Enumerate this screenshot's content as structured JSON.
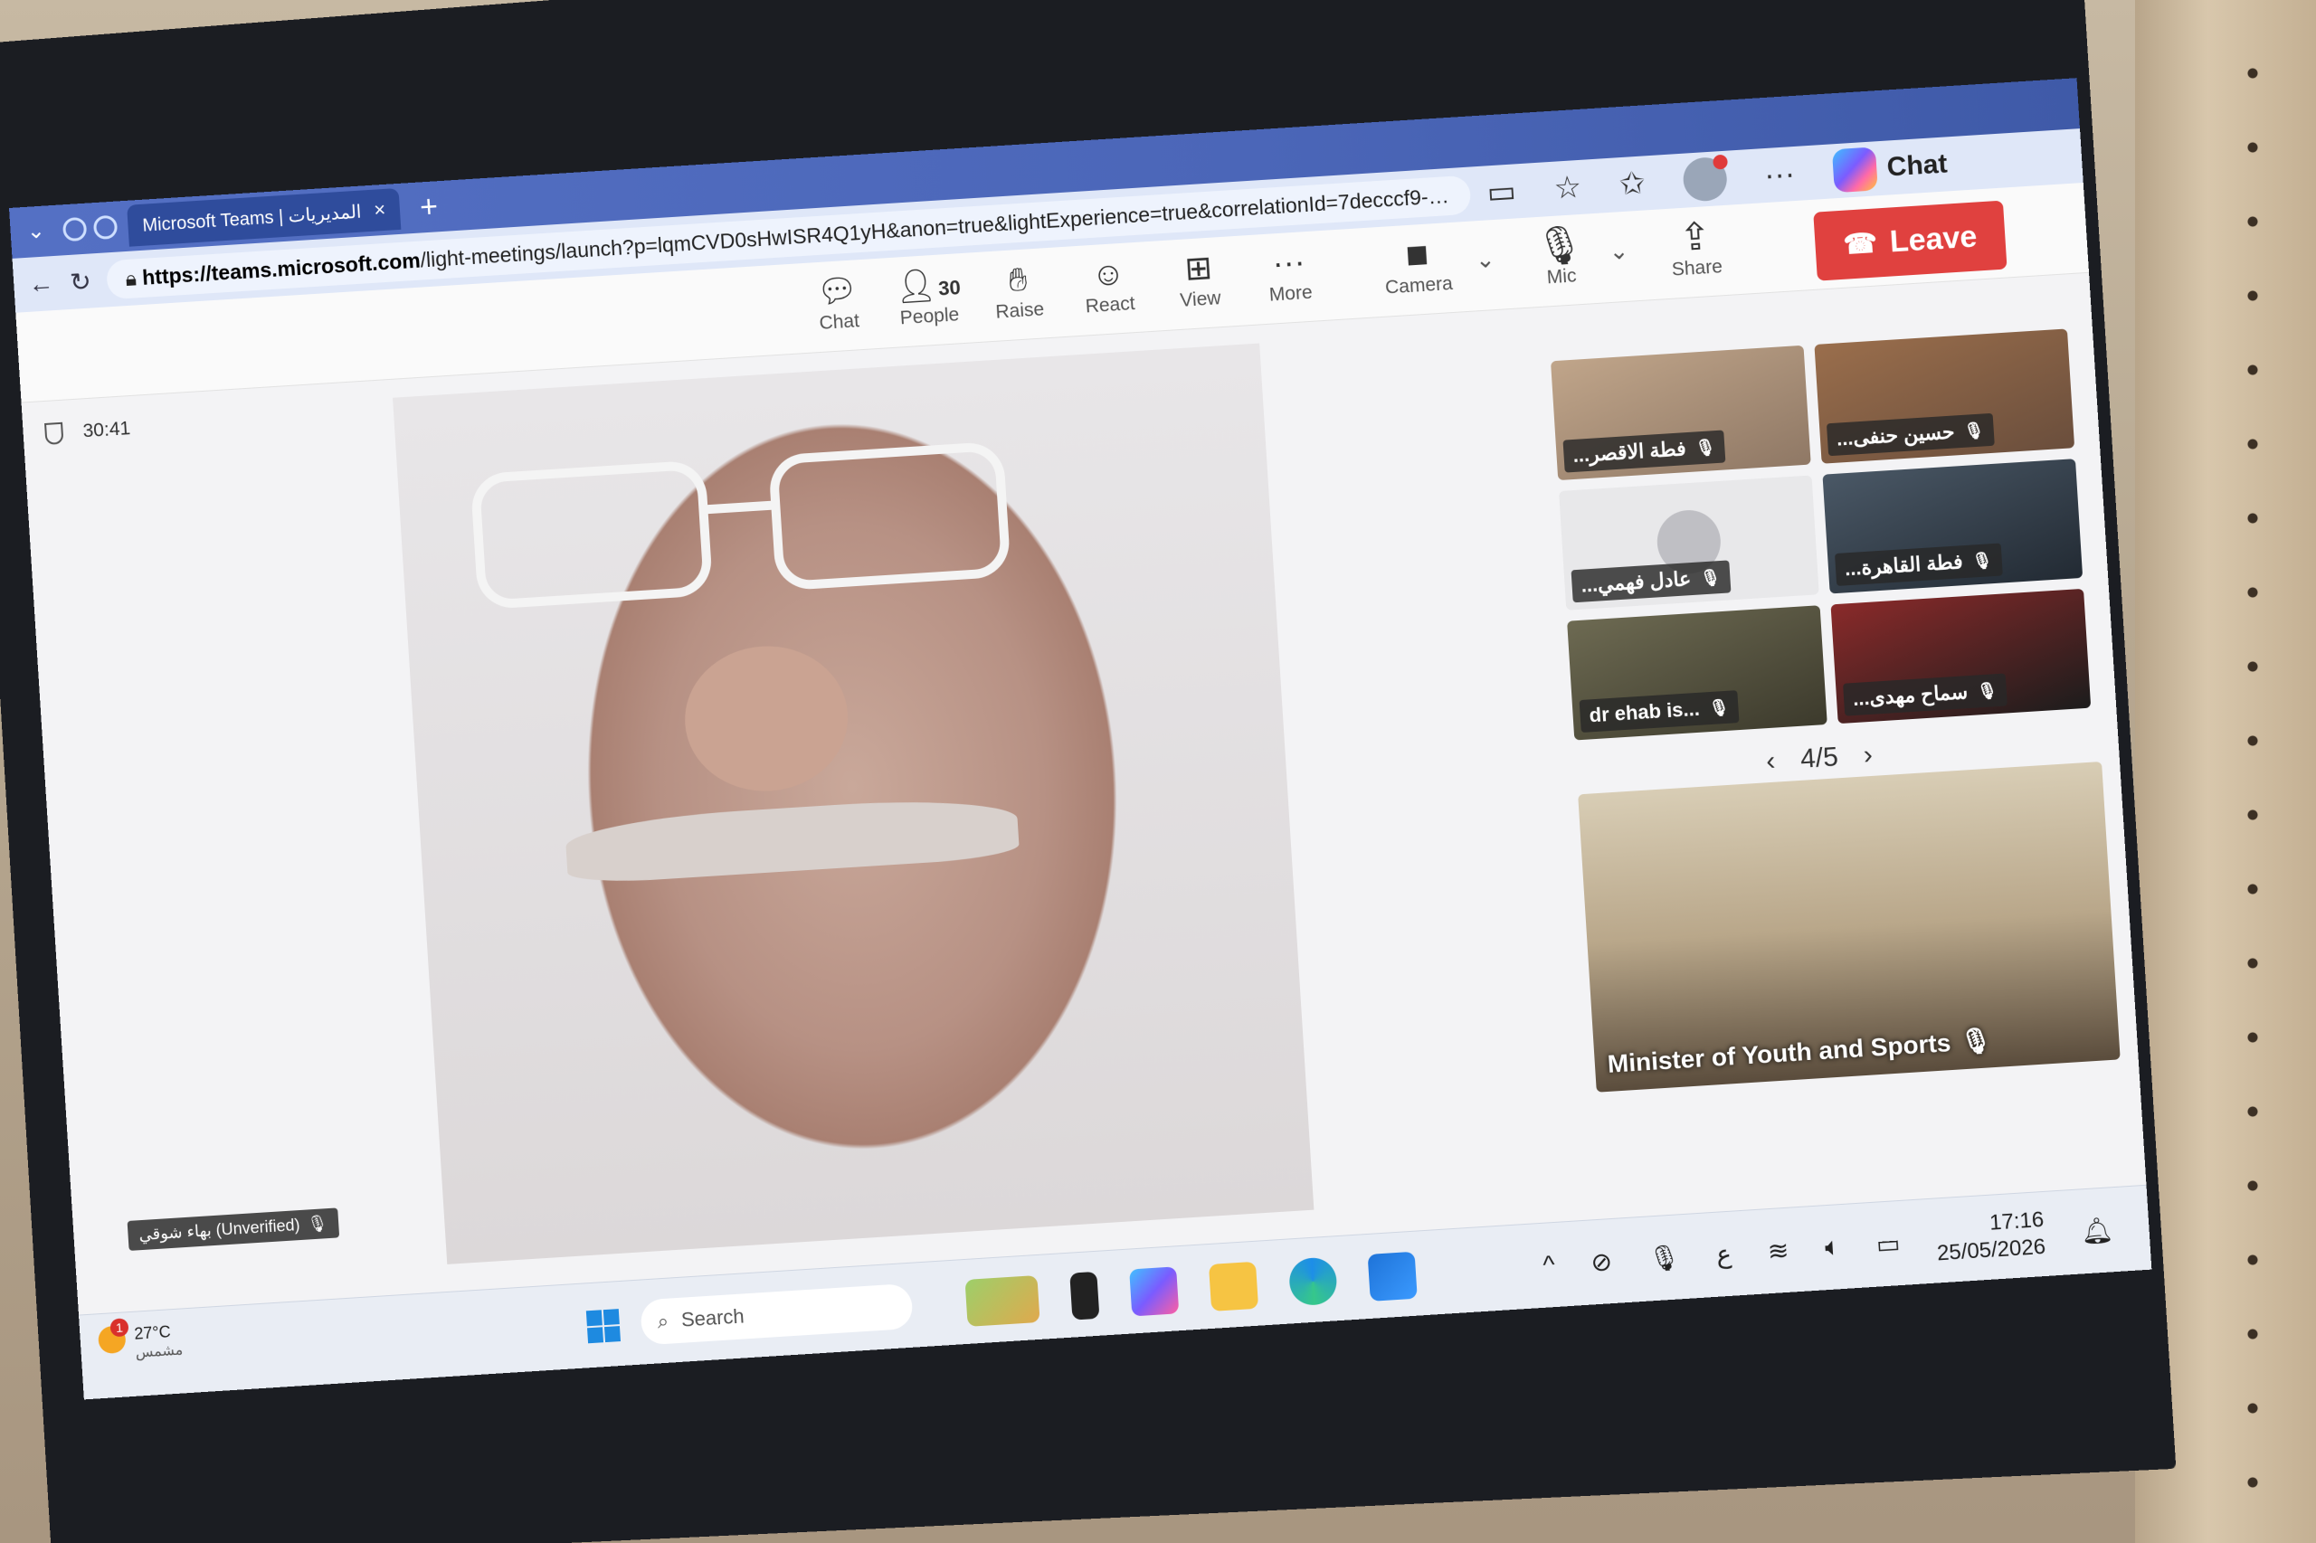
{
  "browser": {
    "tab_title": "Microsoft Teams | المديريات",
    "tab_close": "×",
    "new_tab": "+",
    "url_host": "https://teams.microsoft.com",
    "url_rest": "/light-meetings/launch?p=lqmCVD0sHwISR4Q1yH&anon=true&lightExperience=true&correlationId=7decccf9-a857-4...",
    "copilot_label": "Chat",
    "more_label": "···"
  },
  "toolbar": {
    "chat": "Chat",
    "people": "People",
    "people_count": "30",
    "raise": "Raise",
    "react": "React",
    "view": "View",
    "more": "More",
    "camera": "Camera",
    "mic": "Mic",
    "share": "Share",
    "leave": "Leave"
  },
  "meeting": {
    "timer": "30:41",
    "main_speaker_label": "بهاء شوقي (Unverified)",
    "pager": "4/5",
    "participants": [
      {
        "name": "...فطة الاقصر"
      },
      {
        "name": "...حسين حنفى"
      },
      {
        "name": "...عادل فهمي"
      },
      {
        "name": "...فطة القاهرة"
      },
      {
        "name": "dr ehab is..."
      },
      {
        "name": "...سماح مهدى"
      }
    ],
    "featured_label": "Minister of Youth and Sports"
  },
  "taskbar": {
    "temperature": "27°C",
    "weather_text": "مشمس",
    "weather_badge": "1",
    "search_placeholder": "Search",
    "language": "ع",
    "time": "17:16",
    "date": "25/05/2026"
  },
  "colors": {
    "leave_button": "#e0413f",
    "tab_bar": "#4b66b8",
    "taskbar": "#e9edf4"
  }
}
